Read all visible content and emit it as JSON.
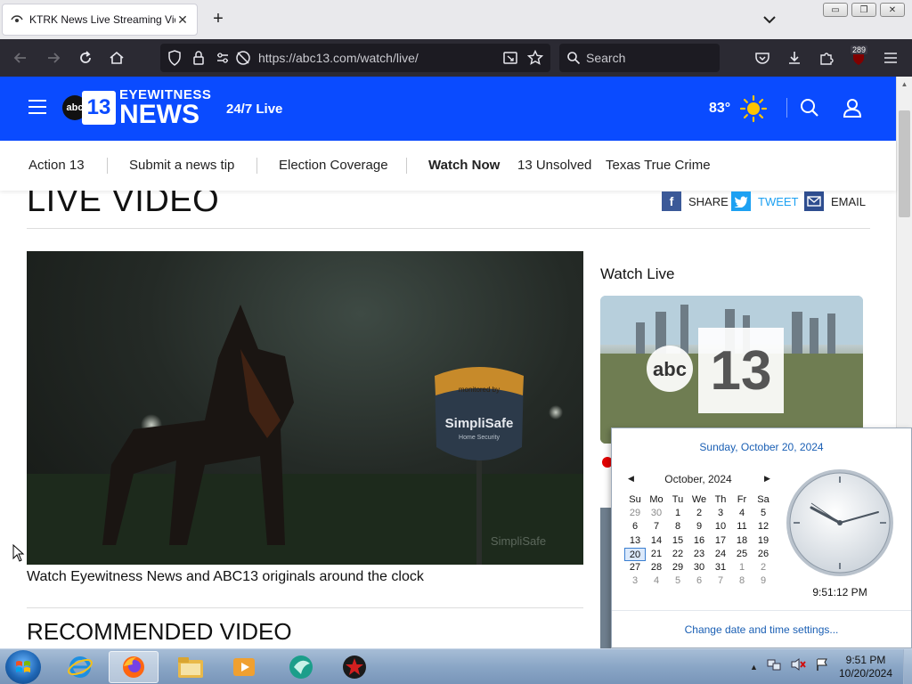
{
  "browser": {
    "tab_title": "KTRK News Live Streaming Vide",
    "new_tab": "+",
    "url": "https://abc13.com/watch/live/",
    "search_placeholder": "Search",
    "extensions_badge": "289"
  },
  "site": {
    "logo_abc": "abc",
    "logo_13": "13",
    "logo_eyewitness": "EYEWITNESS",
    "logo_news": "NEWS",
    "live_link": "24/7 Live",
    "temperature": "83°"
  },
  "subnav": {
    "items": [
      "Action 13",
      "Submit a news tip",
      "Election Coverage",
      "Watch Now",
      "13 Unsolved",
      "Texas True Crime"
    ]
  },
  "page": {
    "title": "LIVE VIDEO",
    "share_label": "SHARE",
    "tweet_label": "TWEET",
    "email_label": "EMAIL",
    "video_caption": "Watch Eyewitness News and ABC13 originals around the clock",
    "recommended_title": "RECOMMENDED VIDEO",
    "watch_live_heading": "Watch Live",
    "video_sign_top": "monitored by",
    "video_sign_brand": "SimpliSafe",
    "video_sign_sub": "Home Security",
    "video_watermark": "SimpliSafe"
  },
  "calendar": {
    "full_date": "Sunday, October 20, 2024",
    "month_label": "October, 2024",
    "weekdays": [
      "Su",
      "Mo",
      "Tu",
      "We",
      "Th",
      "Fr",
      "Sa"
    ],
    "weeks": [
      [
        "29",
        "30",
        "1",
        "2",
        "3",
        "4",
        "5"
      ],
      [
        "6",
        "7",
        "8",
        "9",
        "10",
        "11",
        "12"
      ],
      [
        "13",
        "14",
        "15",
        "16",
        "17",
        "18",
        "19"
      ],
      [
        "20",
        "21",
        "22",
        "23",
        "24",
        "25",
        "26"
      ],
      [
        "27",
        "28",
        "29",
        "30",
        "31",
        "1",
        "2"
      ],
      [
        "3",
        "4",
        "5",
        "6",
        "7",
        "8",
        "9"
      ]
    ],
    "clock_time": "9:51:12 PM",
    "change_link": "Change date and time settings..."
  },
  "taskbar": {
    "time": "9:51 PM",
    "date": "10/20/2024"
  },
  "colors": {
    "brand_blue": "#0a4bff",
    "browser_dark": "#2b2a33",
    "link_blue": "#1a5fb4",
    "facebook": "#3b5998",
    "twitter": "#1da1f2",
    "email": "#2e4d8f"
  }
}
